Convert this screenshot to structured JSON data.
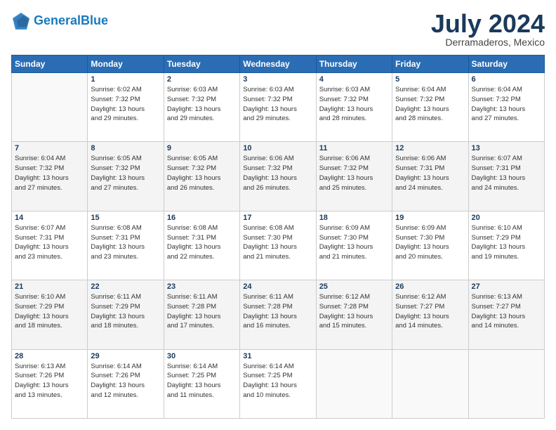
{
  "logo": {
    "line1": "General",
    "line2": "Blue"
  },
  "title": "July 2024",
  "subtitle": "Derramaderos, Mexico",
  "days_header": [
    "Sunday",
    "Monday",
    "Tuesday",
    "Wednesday",
    "Thursday",
    "Friday",
    "Saturday"
  ],
  "weeks": [
    {
      "shaded": false,
      "days": [
        {
          "num": "",
          "info": ""
        },
        {
          "num": "1",
          "info": "Sunrise: 6:02 AM\nSunset: 7:32 PM\nDaylight: 13 hours\nand 29 minutes."
        },
        {
          "num": "2",
          "info": "Sunrise: 6:03 AM\nSunset: 7:32 PM\nDaylight: 13 hours\nand 29 minutes."
        },
        {
          "num": "3",
          "info": "Sunrise: 6:03 AM\nSunset: 7:32 PM\nDaylight: 13 hours\nand 29 minutes."
        },
        {
          "num": "4",
          "info": "Sunrise: 6:03 AM\nSunset: 7:32 PM\nDaylight: 13 hours\nand 28 minutes."
        },
        {
          "num": "5",
          "info": "Sunrise: 6:04 AM\nSunset: 7:32 PM\nDaylight: 13 hours\nand 28 minutes."
        },
        {
          "num": "6",
          "info": "Sunrise: 6:04 AM\nSunset: 7:32 PM\nDaylight: 13 hours\nand 27 minutes."
        }
      ]
    },
    {
      "shaded": true,
      "days": [
        {
          "num": "7",
          "info": "Sunrise: 6:04 AM\nSunset: 7:32 PM\nDaylight: 13 hours\nand 27 minutes."
        },
        {
          "num": "8",
          "info": "Sunrise: 6:05 AM\nSunset: 7:32 PM\nDaylight: 13 hours\nand 27 minutes."
        },
        {
          "num": "9",
          "info": "Sunrise: 6:05 AM\nSunset: 7:32 PM\nDaylight: 13 hours\nand 26 minutes."
        },
        {
          "num": "10",
          "info": "Sunrise: 6:06 AM\nSunset: 7:32 PM\nDaylight: 13 hours\nand 26 minutes."
        },
        {
          "num": "11",
          "info": "Sunrise: 6:06 AM\nSunset: 7:32 PM\nDaylight: 13 hours\nand 25 minutes."
        },
        {
          "num": "12",
          "info": "Sunrise: 6:06 AM\nSunset: 7:31 PM\nDaylight: 13 hours\nand 24 minutes."
        },
        {
          "num": "13",
          "info": "Sunrise: 6:07 AM\nSunset: 7:31 PM\nDaylight: 13 hours\nand 24 minutes."
        }
      ]
    },
    {
      "shaded": false,
      "days": [
        {
          "num": "14",
          "info": "Sunrise: 6:07 AM\nSunset: 7:31 PM\nDaylight: 13 hours\nand 23 minutes."
        },
        {
          "num": "15",
          "info": "Sunrise: 6:08 AM\nSunset: 7:31 PM\nDaylight: 13 hours\nand 23 minutes."
        },
        {
          "num": "16",
          "info": "Sunrise: 6:08 AM\nSunset: 7:31 PM\nDaylight: 13 hours\nand 22 minutes."
        },
        {
          "num": "17",
          "info": "Sunrise: 6:08 AM\nSunset: 7:30 PM\nDaylight: 13 hours\nand 21 minutes."
        },
        {
          "num": "18",
          "info": "Sunrise: 6:09 AM\nSunset: 7:30 PM\nDaylight: 13 hours\nand 21 minutes."
        },
        {
          "num": "19",
          "info": "Sunrise: 6:09 AM\nSunset: 7:30 PM\nDaylight: 13 hours\nand 20 minutes."
        },
        {
          "num": "20",
          "info": "Sunrise: 6:10 AM\nSunset: 7:29 PM\nDaylight: 13 hours\nand 19 minutes."
        }
      ]
    },
    {
      "shaded": true,
      "days": [
        {
          "num": "21",
          "info": "Sunrise: 6:10 AM\nSunset: 7:29 PM\nDaylight: 13 hours\nand 18 minutes."
        },
        {
          "num": "22",
          "info": "Sunrise: 6:11 AM\nSunset: 7:29 PM\nDaylight: 13 hours\nand 18 minutes."
        },
        {
          "num": "23",
          "info": "Sunrise: 6:11 AM\nSunset: 7:28 PM\nDaylight: 13 hours\nand 17 minutes."
        },
        {
          "num": "24",
          "info": "Sunrise: 6:11 AM\nSunset: 7:28 PM\nDaylight: 13 hours\nand 16 minutes."
        },
        {
          "num": "25",
          "info": "Sunrise: 6:12 AM\nSunset: 7:28 PM\nDaylight: 13 hours\nand 15 minutes."
        },
        {
          "num": "26",
          "info": "Sunrise: 6:12 AM\nSunset: 7:27 PM\nDaylight: 13 hours\nand 14 minutes."
        },
        {
          "num": "27",
          "info": "Sunrise: 6:13 AM\nSunset: 7:27 PM\nDaylight: 13 hours\nand 14 minutes."
        }
      ]
    },
    {
      "shaded": false,
      "days": [
        {
          "num": "28",
          "info": "Sunrise: 6:13 AM\nSunset: 7:26 PM\nDaylight: 13 hours\nand 13 minutes."
        },
        {
          "num": "29",
          "info": "Sunrise: 6:14 AM\nSunset: 7:26 PM\nDaylight: 13 hours\nand 12 minutes."
        },
        {
          "num": "30",
          "info": "Sunrise: 6:14 AM\nSunset: 7:25 PM\nDaylight: 13 hours\nand 11 minutes."
        },
        {
          "num": "31",
          "info": "Sunrise: 6:14 AM\nSunset: 7:25 PM\nDaylight: 13 hours\nand 10 minutes."
        },
        {
          "num": "",
          "info": ""
        },
        {
          "num": "",
          "info": ""
        },
        {
          "num": "",
          "info": ""
        }
      ]
    }
  ]
}
